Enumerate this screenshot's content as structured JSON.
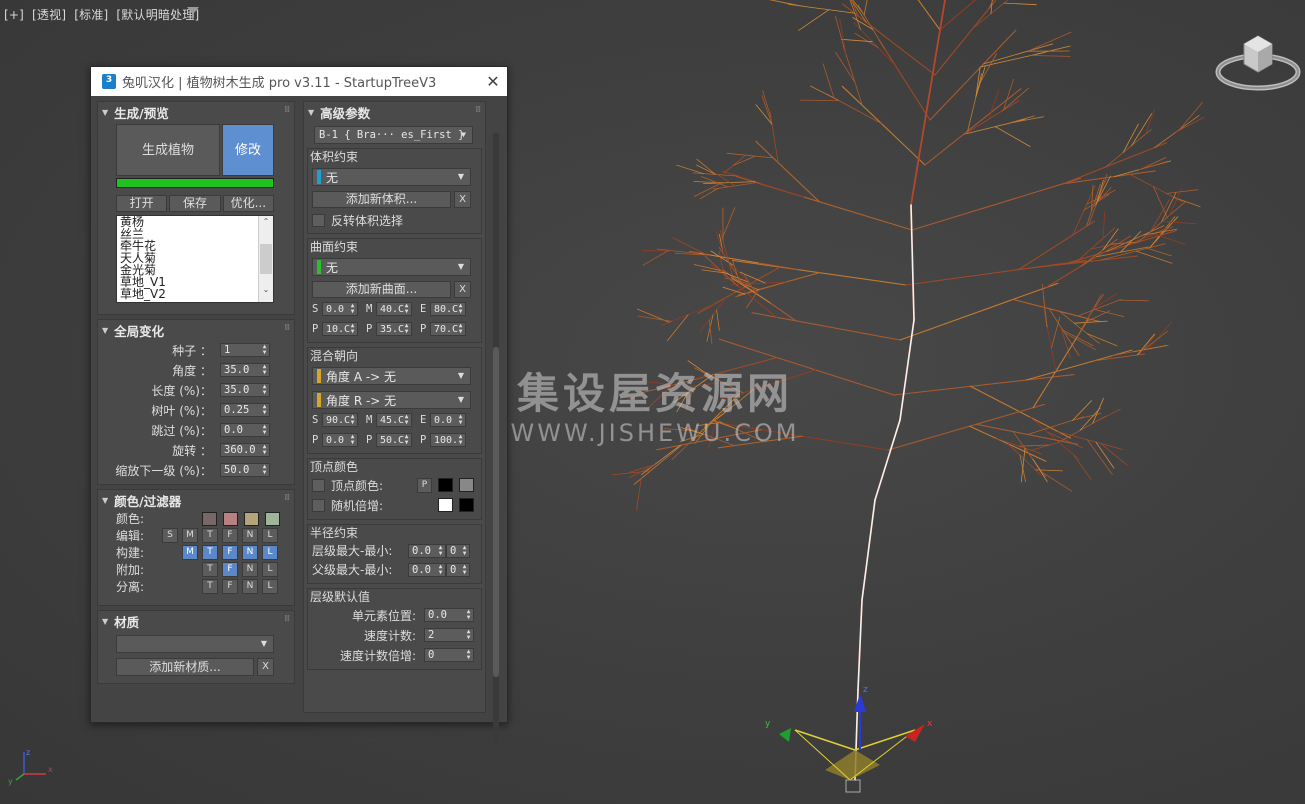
{
  "viewport": {
    "labels": [
      "[+]",
      "[透视]",
      "[标准]",
      "[默认明暗处理]"
    ],
    "axis_labels": {
      "x": "x",
      "y": "y",
      "z": "z"
    }
  },
  "watermark": {
    "cn": "集设屋资源网",
    "en": "WWW.JISHEWU.COM"
  },
  "dialog": {
    "title": "兔叽汉化 | 植物树木生成 pro v3.11 - StartupTreeV3",
    "close": "✕"
  },
  "left": {
    "gen_panel": {
      "title": "生成/预览",
      "generate": "生成植物",
      "modify": "修改",
      "progress": 1.0,
      "open": "打开",
      "save": "保存",
      "optimize": "优化...",
      "list": [
        "黄杨",
        "丝兰",
        "牵牛花",
        "天人菊",
        "金光菊",
        "草地_V1",
        "草地_V2"
      ]
    },
    "global_panel": {
      "title": "全局变化",
      "rows": [
        {
          "label": "种子 ：",
          "value": "1"
        },
        {
          "label": "角度 ：",
          "value": "35.0"
        },
        {
          "label": "长度 (%)：",
          "value": "35.0"
        },
        {
          "label": "树叶 (%)：",
          "value": "0.25"
        },
        {
          "label": "跳过 (%)：",
          "value": "0.0"
        },
        {
          "label": "旋转 ：",
          "value": "360.0"
        },
        {
          "label": "缩放下一级 (%)：",
          "value": "50.0"
        }
      ]
    },
    "color_panel": {
      "title": "颜色/过滤器",
      "color_label": "颜色:",
      "colors": [
        "#7a6666",
        "#b88080",
        "#b5a47a",
        "#9fb59a"
      ],
      "rows": [
        {
          "label": "编辑:",
          "toggles": [
            "S",
            "M",
            "T",
            "F",
            "N",
            "L"
          ],
          "on": []
        },
        {
          "label": "构建:",
          "toggles": [
            "M",
            "T",
            "F",
            "N",
            "L"
          ],
          "on": [
            "M",
            "T",
            "F",
            "N",
            "L"
          ]
        },
        {
          "label": "附加:",
          "toggles": [
            "T",
            "F",
            "N",
            "L"
          ],
          "on": [
            "F"
          ]
        },
        {
          "label": "分离:",
          "toggles": [
            "T",
            "F",
            "N",
            "L"
          ],
          "on": []
        }
      ]
    },
    "material_panel": {
      "title": "材质",
      "add": "添加新材质...",
      "x": "X"
    }
  },
  "right": {
    "advanced_title": "高级参数",
    "branch_select": "B-1  { Bra··· es_First }",
    "volume": {
      "title": "体积约束",
      "select": "无",
      "color": "#1e9fd6",
      "add": "添加新体积...",
      "x": "X",
      "invert": "反转体积选择"
    },
    "surface": {
      "title": "曲面约束",
      "select": "无",
      "color": "#2bbf2b",
      "add": "添加新曲面...",
      "x": "X",
      "row1": [
        {
          "k": "S",
          "v": "0.0"
        },
        {
          "k": "M",
          "v": "40.C"
        },
        {
          "k": "E",
          "v": "80.C"
        }
      ],
      "row2": [
        {
          "k": "P",
          "v": "10.C"
        },
        {
          "k": "P",
          "v": "35.C"
        },
        {
          "k": "P",
          "v": "70.C"
        }
      ]
    },
    "blend": {
      "title": "混合朝向",
      "angle_a": "角度 A -> 无",
      "angle_r": "角度 R -> 无",
      "color": "#d4a62a",
      "row1": [
        {
          "k": "S",
          "v": "90.C"
        },
        {
          "k": "M",
          "v": "45.C"
        },
        {
          "k": "E",
          "v": "0.0"
        }
      ],
      "row2": [
        {
          "k": "P",
          "v": "0.0"
        },
        {
          "k": "P",
          "v": "50.C"
        },
        {
          "k": "P",
          "v": "100."
        }
      ]
    },
    "vertex": {
      "title": "顶点颜色",
      "vc_label": "顶点颜色:",
      "p": "P",
      "random": "随机倍增:"
    },
    "radius": {
      "title": "半径约束",
      "level": "层级最大-最小:",
      "parent": "父级最大-最小:",
      "level_v": [
        "0.0",
        "0"
      ],
      "parent_v": [
        "0.0",
        "0"
      ]
    },
    "defaults": {
      "title": "层级默认值",
      "rows": [
        {
          "label": "单元素位置:",
          "value": "0.0"
        },
        {
          "label": "速度计数:",
          "value": "2"
        },
        {
          "label": "速度计数倍增:",
          "value": "0"
        }
      ]
    }
  }
}
